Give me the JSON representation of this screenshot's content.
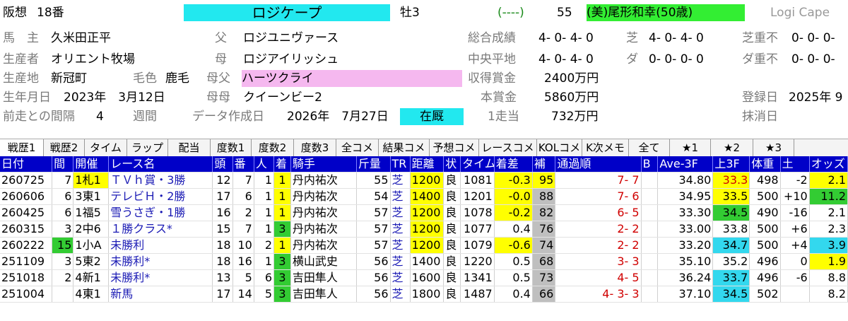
{
  "header": {
    "track": "阪想",
    "num": "18番",
    "horse_name": "ロジケープ",
    "sex_age": "牡3",
    "mark": "(----)",
    "weight": "55",
    "jockey_trainer": "(美)尾形和幸(50歳)",
    "romaji": "Logi Cape",
    "owner_label": "馬　主",
    "owner": "久米田正平",
    "breeder_label": "生産者",
    "breeder": "オリエント牧場",
    "birthplace_label": "生産地",
    "birthplace": "新冠町",
    "coat_label": "毛色",
    "coat": "鹿毛",
    "birth_label": "生年月日",
    "birth": "2023年　3月12日",
    "interval_label": "前走との間隔",
    "interval": "4",
    "interval_unit": "週間",
    "sire_label": "父",
    "sire": "ロジユニヴァース",
    "dam_label": "母",
    "dam": "ロジアイリッシュ",
    "damsire_label": "母父",
    "damsire": "ハーツクライ",
    "damdam_label": "母母",
    "damdam": "クイーンビー2",
    "created_label": "データ作成日",
    "created": "2026年　7月27日",
    "status": "在厩",
    "total_label": "総合成績",
    "total": "4- 0- 4- 0",
    "central_label": "中央平地",
    "central": "4- 0- 4- 0",
    "earned_label": "収得賞金",
    "earned": "2400万円",
    "prize_label": "本賞金",
    "prize": "5860万円",
    "per_label": "1走当",
    "per": "732万円",
    "turf_label": "芝",
    "turf": "4- 0- 4- 0",
    "dirt_label": "ダ",
    "dirt": "0- 0- 0- 0",
    "turfheavy_label": "芝重不",
    "turfheavy": "0- 0- 0-",
    "dirtheavy_label": "ダ重不",
    "dirtheavy": "0- 0- 0-",
    "reg_label": "登録日",
    "reg": "2025年 9",
    "del_label": "抹消日"
  },
  "tabs": [
    "戦歴1",
    "戦歴2",
    "タイム",
    "ラップ",
    "配当",
    "度数1",
    "度数2",
    "度数3",
    "全コメ",
    "結果コメ",
    "予想コメ",
    "レースコメ",
    "KOLコメ",
    "K次メモ",
    "全て",
    "★1",
    "★2",
    "★3"
  ],
  "columns": [
    "日付",
    "間",
    "開催",
    "レース名",
    "頭",
    "番",
    "人",
    "着",
    "騎手",
    "斤量",
    "TR",
    "距離",
    "状",
    "タイム",
    "着差",
    "補",
    "通過順",
    "B",
    "Ave-3F",
    "上3F",
    "体重",
    "土",
    "オッズ"
  ],
  "rows": [
    {
      "date": "260725",
      "gap": "7",
      "meet": "1札1",
      "race": "ＴＶｈ賞・3勝",
      "heads": "12",
      "num": "7",
      "pop": "1",
      "rank": "1",
      "jockey": "丹内祐次",
      "kin": "55",
      "tr": "芝",
      "dist": "1200",
      "cond": "良",
      "time": "1081",
      "diff": "-0.3",
      "ho": "95",
      "pass": "7- 7",
      "b": "",
      "ave": "34.80",
      "up": "33.3",
      "wt": "498",
      "chg": "-2",
      "odds": "2.1"
    },
    {
      "date": "260606",
      "gap": "6",
      "meet": "3東1",
      "race": "テレビＨ・2勝",
      "heads": "17",
      "num": "6",
      "pop": "1",
      "rank": "1",
      "jockey": "丹内祐次",
      "kin": "54",
      "tr": "芝",
      "dist": "1400",
      "cond": "良",
      "time": "1201",
      "diff": "-0.0",
      "ho": "88",
      "pass": "7- 6",
      "b": "",
      "ave": "34.95",
      "up": "33.5",
      "wt": "500",
      "chg": "+10",
      "odds": "11.2"
    },
    {
      "date": "260425",
      "gap": "6",
      "meet": "1福5",
      "race": "雪うさぎ・1勝",
      "heads": "16",
      "num": "2",
      "pop": "1",
      "rank": "1",
      "jockey": "丹内祐次",
      "kin": "57",
      "tr": "芝",
      "dist": "1200",
      "cond": "良",
      "time": "1078",
      "diff": "-0.2",
      "ho": "82",
      "pass": "6- 5",
      "b": "",
      "ave": "33.30",
      "up": "34.5",
      "wt": "490",
      "chg": "-16",
      "odds": "2.1"
    },
    {
      "date": "260315",
      "gap": "3",
      "meet": "2中6",
      "race": "１勝クラス*",
      "heads": "15",
      "num": "7",
      "pop": "1",
      "rank": "3",
      "jockey": "丹内祐次",
      "kin": "57",
      "tr": "芝",
      "dist": "1200",
      "cond": "良",
      "time": "1077",
      "diff": "0.4",
      "ho": "76",
      "pass": "2- 2",
      "b": "",
      "ave": "33.00",
      "up": "33.8",
      "wt": "500",
      "chg": "+6",
      "odds": "2.3"
    },
    {
      "date": "260222",
      "gap": "15",
      "meet": "1小A",
      "race": "未勝利",
      "heads": "18",
      "num": "10",
      "pop": "2",
      "rank": "1",
      "jockey": "丹内祐次",
      "kin": "57",
      "tr": "芝",
      "dist": "1200",
      "cond": "良",
      "time": "1079",
      "diff": "-0.6",
      "ho": "74",
      "pass": "2- 2",
      "b": "",
      "ave": "33.20",
      "up": "34.7",
      "wt": "500",
      "chg": "+4",
      "odds": "3.9"
    },
    {
      "date": "251109",
      "gap": "3",
      "meet": "5東2",
      "race": "未勝利*",
      "heads": "18",
      "num": "16",
      "pop": "1",
      "rank": "3",
      "jockey": "横山武史",
      "kin": "56",
      "tr": "芝",
      "dist": "1400",
      "cond": "良",
      "time": "1220",
      "diff": "0.5",
      "ho": "68",
      "pass": "3- 3",
      "b": "",
      "ave": "35.10",
      "up": "35.2",
      "wt": "496",
      "chg": "0",
      "odds": "1.9"
    },
    {
      "date": "251018",
      "gap": "2",
      "meet": "4新1",
      "race": "未勝利*",
      "heads": "13",
      "num": "5",
      "pop": "6",
      "rank": "3",
      "jockey": "吉田隼人",
      "kin": "56",
      "tr": "芝",
      "dist": "1600",
      "cond": "良",
      "time": "1341",
      "diff": "0.5",
      "ho": "73",
      "pass": "4- 5",
      "b": "",
      "ave": "36.24",
      "up": "33.7",
      "wt": "496",
      "chg": "-6",
      "odds": "8.8"
    },
    {
      "date": "251004",
      "gap": "",
      "meet": "4東1",
      "race": "新馬",
      "heads": "17",
      "num": "14",
      "pop": "5",
      "rank": "3",
      "jockey": "吉田隼人",
      "kin": "56",
      "tr": "芝",
      "dist": "1800",
      "cond": "良",
      "time": "1487",
      "diff": "0.4",
      "ho": "66",
      "pass": "4- 3- 3",
      "b": "",
      "ave": "37.10",
      "up": "34.5",
      "wt": "502",
      "chg": "",
      "odds": "8.2"
    }
  ]
}
